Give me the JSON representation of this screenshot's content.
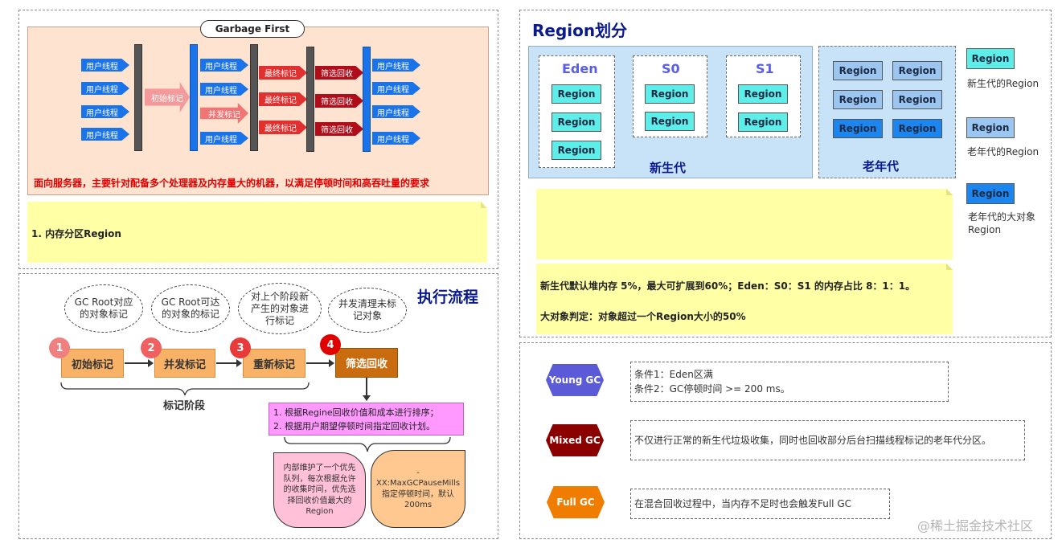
{
  "gc_diagram": {
    "title": "Garbage First",
    "thread_label": "用户线程",
    "initial_mark": "初始标记",
    "concurrent_mark": "并发标记",
    "final_mark": "最终标记",
    "cleanup": "筛选回收",
    "description": "面向服务器，主要针对配备多个处理器及内存量大的机器，以满足停顿时间和高吞吐量的要求"
  },
  "note_left": "1. 内存分区Region",
  "process": {
    "title": "执行流程",
    "clouds": [
      "GC Root对应的对象标记",
      "GC Root可达的对象的标记",
      "对上个阶段新产生的对象进行标记",
      "并发清理未标记对象"
    ],
    "steps": [
      {
        "num": "1",
        "label": "初始标记"
      },
      {
        "num": "2",
        "label": "并发标记"
      },
      {
        "num": "3",
        "label": "重新标记"
      },
      {
        "num": "4",
        "label": "筛选回收"
      }
    ],
    "phase_label": "标记阶段",
    "cleanup_notes": [
      "1. 根据Regine回收价值和成本进行排序；",
      "2. 根据用户期望停顿时间指定回收计划。"
    ],
    "bubble_left": "内部维护了一个优先队列，每次根据允许的收集时间，优先选择回收价值最大的Region",
    "bubble_right": "-XX:MaxGCPauseMills指定停顿时间，默认200ms"
  },
  "region_section": {
    "title": "Region划分",
    "eden": "Eden",
    "s0": "S0",
    "s1": "S1",
    "region_label": "Region",
    "young_label": "新生代",
    "old_label": "老年代",
    "legend": [
      {
        "box": "Region",
        "text": "新生代的Region"
      },
      {
        "box": "Region",
        "text": "老年代的Region"
      },
      {
        "box": "Region",
        "text": "老年代的大对象Region"
      }
    ],
    "note_line1": "新生代默认堆内存 5%，最大可扩展到60%；Eden：S0：S1 的内存占比 8：1：1。",
    "note_line2": "大对象判定：对象超过一个Region大小的50%"
  },
  "gc_types": [
    {
      "name": "Young GC",
      "lines": [
        "条件1：Eden区满",
        "条件2：GC停顿时间 >= 200 ms。"
      ]
    },
    {
      "name": "Mixed GC",
      "lines": [
        "不仅进行正常的新生代垃圾收集，同时也回收部分后台扫描线程标记的老年代分区。"
      ]
    },
    {
      "name": "Full GC",
      "lines": [
        "在混合回收过程中，当内存不足时也会触发Full GC"
      ]
    }
  ],
  "watermark": "@稀土掘金技术社区",
  "colors": {
    "young_region": "#5eeeea",
    "old_region": "#9cc6f2",
    "huge_region": "#1c86f0",
    "young_gc": "#5b5bd8",
    "mixed_gc": "#8b0000",
    "full_gc": "#f07c00",
    "title_blue": "#0a1a8c"
  }
}
